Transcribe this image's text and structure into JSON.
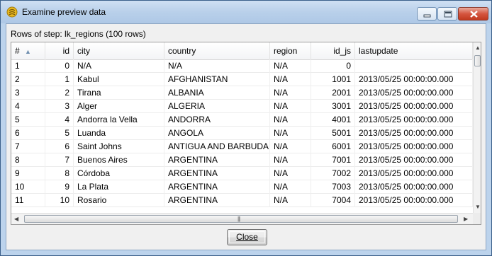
{
  "window": {
    "title": "Examine preview data"
  },
  "rows_label": "Rows of step: lk_regions (100 rows)",
  "columns": [
    "#",
    "id",
    "city",
    "country",
    "region",
    "id_js",
    "lastupdate"
  ],
  "rows": [
    [
      "1",
      "0",
      "N/A",
      "N/A",
      "N/A",
      "0",
      ""
    ],
    [
      "2",
      "1",
      "Kabul",
      "AFGHANISTAN",
      "N/A",
      "1001",
      "2013/05/25 00:00:00.000"
    ],
    [
      "3",
      "2",
      "Tirana",
      "ALBANIA",
      "N/A",
      "2001",
      "2013/05/25 00:00:00.000"
    ],
    [
      "4",
      "3",
      "Alger",
      "ALGERIA",
      "N/A",
      "3001",
      "2013/05/25 00:00:00.000"
    ],
    [
      "5",
      "4",
      "Andorra la Vella",
      "ANDORRA",
      "N/A",
      "4001",
      "2013/05/25 00:00:00.000"
    ],
    [
      "6",
      "5",
      "Luanda",
      "ANGOLA",
      "N/A",
      "5001",
      "2013/05/25 00:00:00.000"
    ],
    [
      "7",
      "6",
      "Saint Johns",
      "ANTIGUA AND BARBUDA",
      "N/A",
      "6001",
      "2013/05/25 00:00:00.000"
    ],
    [
      "8",
      "7",
      "Buenos Aires",
      "ARGENTINA",
      "N/A",
      "7001",
      "2013/05/25 00:00:00.000"
    ],
    [
      "9",
      "8",
      "Córdoba",
      "ARGENTINA",
      "N/A",
      "7002",
      "2013/05/25 00:00:00.000"
    ],
    [
      "10",
      "9",
      "La Plata",
      "ARGENTINA",
      "N/A",
      "7003",
      "2013/05/25 00:00:00.000"
    ],
    [
      "11",
      "10",
      "Rosario",
      "ARGENTINA",
      "N/A",
      "7004",
      "2013/05/25 00:00:00.000"
    ]
  ],
  "close_button": {
    "label": "Close"
  },
  "icons": {
    "app": "kettle-icon",
    "minimize": "minimize-icon",
    "maximize": "maximize-icon",
    "close": "close-icon",
    "sort": "sort-ascending-icon"
  },
  "colors": {
    "title_bar": "#b9d0ea",
    "close_red": "#c0391f"
  }
}
